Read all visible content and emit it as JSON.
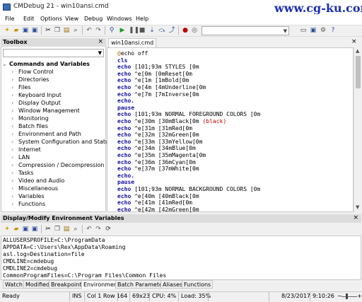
{
  "window": {
    "title": "CMDebug 21 - win10ansi.cmd"
  },
  "watermark": "www.cg-ku.com",
  "menu": [
    "File",
    "Edit",
    "Options",
    "View",
    "Debug",
    "Windows",
    "Help"
  ],
  "toolbox": {
    "title": "Toolbox",
    "close": "×",
    "group": "Commands and Variables",
    "items": [
      "Flow Control",
      "Directories",
      "Files",
      "Keyboard Input",
      "Display Output",
      "Window Management",
      "Monitoring",
      "Batch files",
      "Environment and Path",
      "System Configuration and Status",
      "Internet",
      "LAN",
      "Compression / Decompression",
      "Tasks",
      "Video and Audio",
      "Miscellaneous",
      "Variables",
      "Functions"
    ]
  },
  "editor": {
    "tab": "win10ansi.cmd",
    "close": "×",
    "lines": [
      [
        "@",
        "echo off"
      ],
      [
        "cls",
        ""
      ],
      [
        "echo",
        " [101;93m STYLES [0m"
      ],
      [
        "echo",
        " ^e[0m [0mReset[0m"
      ],
      [
        "echo",
        " ^e[1m [1mBold[0m"
      ],
      [
        "echo",
        " ^e[4m [4mUnderline[0m"
      ],
      [
        "echo",
        " ^e[7m [7mInverse[0m"
      ],
      [
        "echo.",
        ""
      ],
      [
        "pause",
        ""
      ],
      [
        "echo",
        " [101;93m NORMAL FOREGROUND COLORS [0m"
      ],
      [
        "echo",
        " ^e[30m [30mBlack[0m (black)"
      ],
      [
        "echo",
        " ^e[31m [31mRed[0m"
      ],
      [
        "echo",
        " ^e[32m [32mGreen[0m"
      ],
      [
        "echo",
        " ^e[33m [33mYellow[0m"
      ],
      [
        "echo",
        " ^e[34m [34mBlue[0m"
      ],
      [
        "echo",
        " ^e[35m [35mMagenta[0m"
      ],
      [
        "echo",
        " ^e[36m [36mCyan[0m"
      ],
      [
        "echo",
        " ^e[37m [37mWhite[0m"
      ],
      [
        "echo.",
        ""
      ],
      [
        "pause",
        ""
      ],
      [
        "echo",
        " [101;93m NORMAL BACKGROUND COLORS [0m"
      ],
      [
        "echo",
        " ^e[40m [40mBlack[0m"
      ],
      [
        "echo",
        " ^e[41m [41mRed[0m"
      ],
      [
        "echo",
        " ^e[42m [42mGreen[0m"
      ]
    ]
  },
  "env": {
    "title": "Display/Modify Environment Variables",
    "close": "×",
    "lines": [
      "ALLUSERSPROFILE=C:\\ProgramData",
      "APPDATA=C:\\Users\\Rex\\AppData\\Roaming",
      "asl.log=Destination=file",
      "CMDLINE=cmdebug",
      "CMDLINE2=cmdebug",
      "CommonProgramFiles=C:\\Program Files\\Common Files"
    ]
  },
  "bottom_tabs": [
    "Watch",
    "Modified",
    "Breakpoints",
    "Environment",
    "Batch Parameters",
    "Aliases",
    "Functions"
  ],
  "bottom_active": "Environment",
  "status": {
    "ready": "Ready",
    "ins": "INS",
    "col_row": "Col 1  Row 1",
    "value": "64",
    "size": "69x23",
    "cpu": "CPU: 4%",
    "load": "Load: 35%",
    "date": "8/23/2017",
    "time": "9:10:26"
  }
}
